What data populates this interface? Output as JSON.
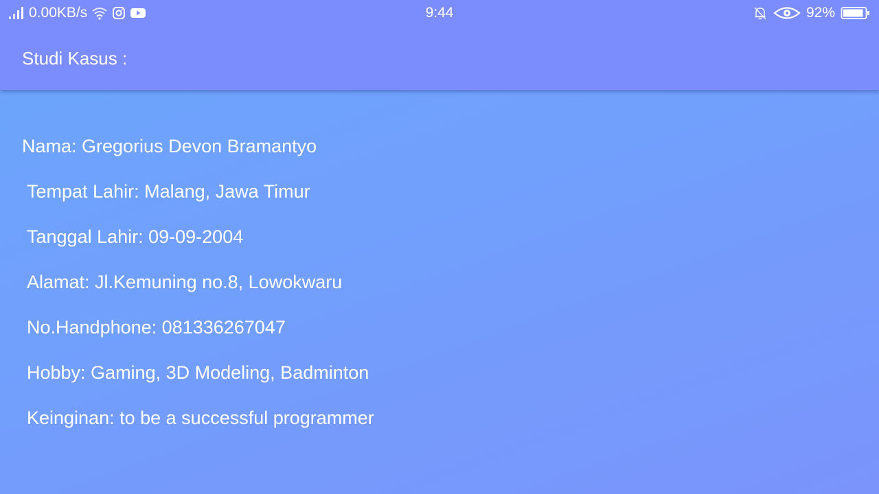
{
  "status_bar": {
    "network_speed": "0.00KB/s",
    "time": "9:44",
    "battery_percent": "92%",
    "battery_level": 0.92,
    "icons": [
      "signal-icon",
      "wifi-icon",
      "instagram-icon",
      "youtube-icon",
      "bell-off-icon",
      "eye-icon",
      "battery-icon"
    ]
  },
  "app_bar": {
    "title": "Studi Kasus :"
  },
  "profile": {
    "lines": [
      "Nama: Gregorius Devon Bramantyo",
      "Tempat Lahir: Malang, Jawa Timur",
      "Tanggal Lahir: 09-09-2004",
      "Alamat: Jl.Kemuning no.8, Lowokwaru",
      "No.Handphone: 081336267047",
      "Hobby: Gaming, 3D Modeling, Badminton",
      "Keinginan: to be a successful programmer"
    ]
  },
  "colors": {
    "app_bar": "#7b8dfd",
    "background_start": "#6ba6fb",
    "background_end": "#7a94fb",
    "text": "#ffffff"
  }
}
